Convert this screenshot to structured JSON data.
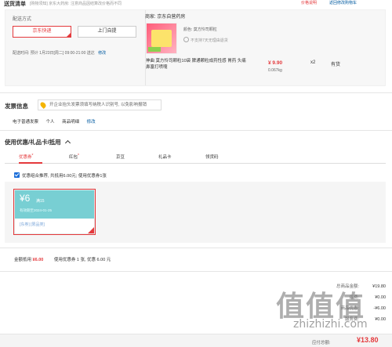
{
  "header": {
    "title": "送货清单",
    "subtitle": "[购物须知] 京东大药房: 注意商品因结算改价格而不同",
    "warning": "价格说明",
    "link": "返回修改购物车"
  },
  "shipping": {
    "label": "配送方式",
    "options": [
      {
        "label": "京东快递",
        "selected": true
      },
      {
        "label": "上门自提",
        "selected": false
      }
    ],
    "time_label": "配送时间:",
    "time_value": "预计 1月23日[周二] 09:00-21:00 送达",
    "edit_label": "修改"
  },
  "item": {
    "shop": "商家: 京东自营药房",
    "color_label": "颜色: 莫方怜司颗粒",
    "return_policy": "不支持7天无理由退货",
    "name": "神曲 莫方怜司颗粒10袋 脾通颗粒成药性感 胃药 头痛鼻塞打喷嚏",
    "price": "¥ 9.90",
    "weight": "0.067kg",
    "qty": "x2",
    "stock": "有货"
  },
  "invoice": {
    "title": "发票信息",
    "tip": "开企业抬头发票须填写纳税人识别号, 以免影响报销",
    "type": "电子普通发票",
    "holder": "个人",
    "content": "商品明细",
    "edit_label": "修改"
  },
  "coupons": {
    "title": "使用优惠/礼品卡/抵用",
    "tabs": [
      {
        "label": "优惠券",
        "star": true,
        "active": true
      },
      {
        "label": "红包",
        "star": true,
        "active": false
      },
      {
        "label": "京豆",
        "star": false,
        "active": false
      },
      {
        "label": "礼品卡",
        "star": false,
        "active": false
      },
      {
        "label": "领货码",
        "star": false,
        "active": false
      }
    ],
    "recommend_label": "优惠组合推荐, 共抵用6.00元; 使用优惠券1张",
    "coupon": {
      "amount": "¥6",
      "condition": "满15",
      "valid": "有效期至2024-01-25",
      "type_label": "[东券] [限品类]"
    },
    "discount_label": "金额抵用",
    "discount_value": "¥6.00",
    "discount_desc": "使用优惠券 1 张, 优惠 6.00 元"
  },
  "summary": {
    "rows": [
      {
        "label": "总商品金额:",
        "value": "¥19.80"
      },
      {
        "label": "运费:",
        "value": "¥0.00"
      },
      {
        "label": "商品优惠:",
        "value": "-¥6.00"
      },
      {
        "label": "服务费:",
        "value": "¥0.00"
      }
    ],
    "payable_label": "应付总额:",
    "payable_value": "¥13.80"
  },
  "watermark": {
    "logo": "值值值",
    "url": "zhizhizhi.com"
  }
}
